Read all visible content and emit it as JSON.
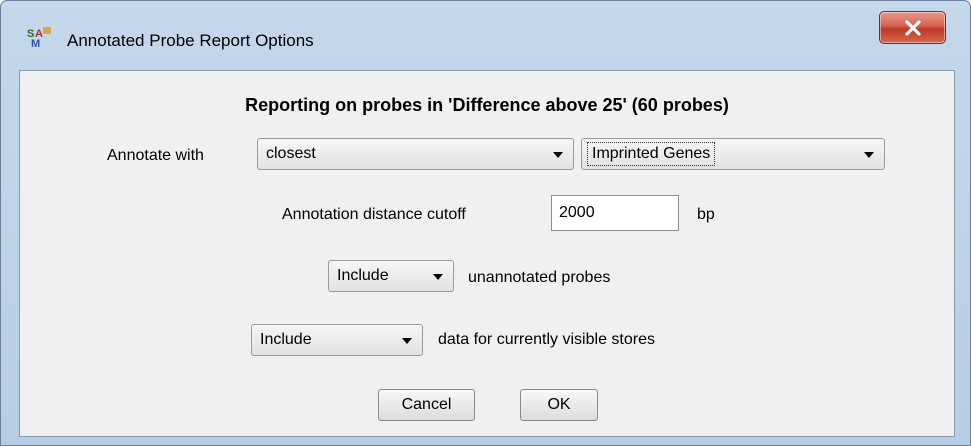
{
  "window": {
    "title": "Annotated Probe Report Options",
    "close_label": "X"
  },
  "dialog": {
    "heading": "Reporting on probes in 'Difference above 25' (60 probes)",
    "annotate_with_label": "Annotate with",
    "annotate_method": "closest",
    "annotate_feature": "Imprinted Genes",
    "distance_label": "Annotation distance cutoff",
    "distance_value": "2000",
    "distance_unit": "bp",
    "unannotated_choice": "Include",
    "unannotated_label": "unannotated probes",
    "visible_stores_choice": "Include",
    "visible_stores_label": "data for currently visible stores",
    "cancel_label": "Cancel",
    "ok_label": "OK"
  }
}
